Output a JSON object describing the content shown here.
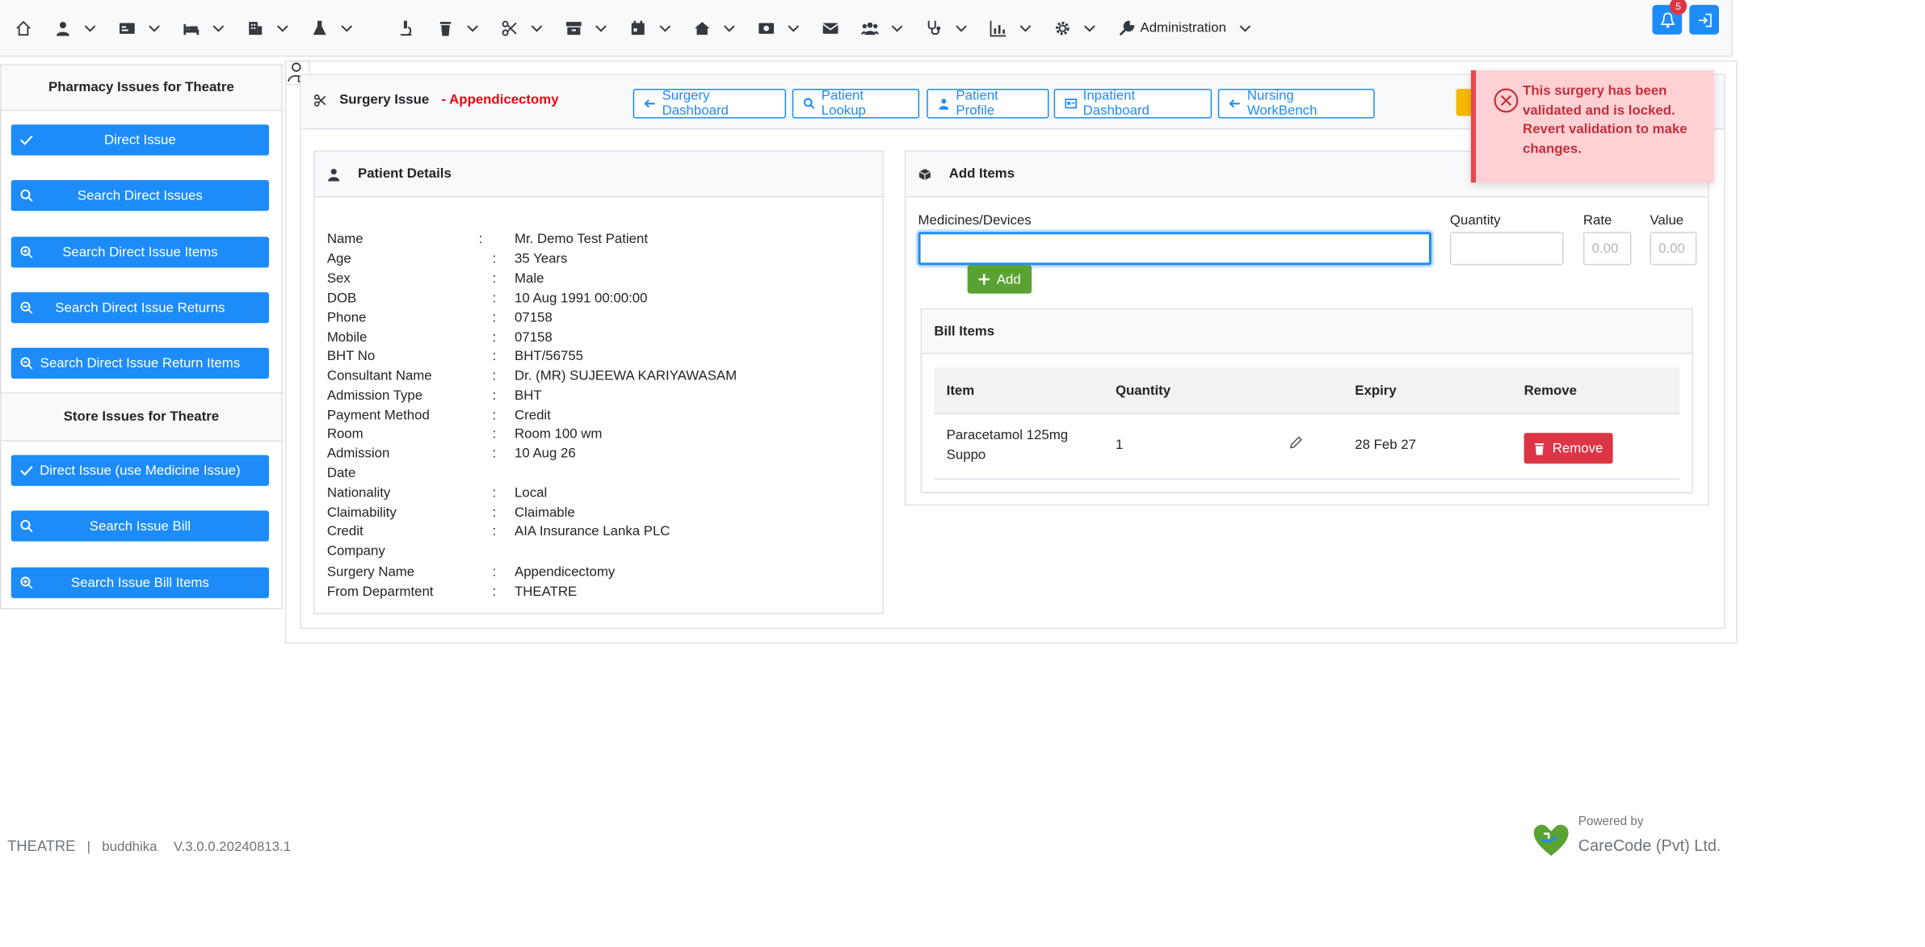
{
  "colors": {
    "primary": "#1d8cf8",
    "danger": "#dc3545",
    "success": "#5aa232",
    "title_accent": "#e50914",
    "toast_bg": "#ffd1d5"
  },
  "navbar": {
    "icons": [
      "home-icon",
      "user-icon",
      "card-icon",
      "bed-icon",
      "building-icon",
      "flask-icon",
      "doctor-icon",
      "microscope-icon",
      "trash-icon",
      "scissors-icon",
      "store-icon",
      "calendar-icon",
      "house-icon",
      "money-icon",
      "mail-icon",
      "users-icon",
      "stethoscope-icon",
      "chart-icon",
      "gear-icon",
      "wrench-icon"
    ],
    "administration_label": "Administration",
    "notification_count": "5"
  },
  "sidebar": {
    "pharmacy_title": "Pharmacy Issues for Theatre",
    "pharmacy_items": [
      {
        "label": "Direct Issue",
        "icon": "check-icon"
      },
      {
        "label": "Search Direct Issues",
        "icon": "search-icon"
      },
      {
        "label": "Search Direct Issue Items",
        "icon": "search-plus-icon"
      },
      {
        "label": "Search Direct Issue Returns",
        "icon": "search-minus-icon"
      },
      {
        "label": "Search Direct Issue Return Items",
        "icon": "search-minus-icon"
      }
    ],
    "store_title": "Store Issues for Theatre",
    "store_items": [
      {
        "label": "Direct Issue (use Medicine Issue)",
        "icon": "check-icon"
      },
      {
        "label": "Search Issue Bill",
        "icon": "search-icon"
      },
      {
        "label": "Search Issue Bill Items",
        "icon": "search-plus-icon"
      }
    ]
  },
  "header": {
    "title": "Surgery Issue",
    "subtitle": "- Appendicectomy",
    "buttons": {
      "surgery_dashboard": "Surgery Dashboard",
      "patient_lookup": "Patient Lookup",
      "patient_profile": "Patient Profile",
      "inpatient_dashboard": "Inpatient Dashboard",
      "nursing_workbench": "Nursing WorkBench"
    }
  },
  "patient_details": {
    "title": "Patient Details",
    "fields": [
      {
        "label": "Name",
        "value": "Mr. Demo Test Patient"
      },
      {
        "label": "Age",
        "value": "35 Years"
      },
      {
        "label": "Sex",
        "value": "Male"
      },
      {
        "label": "DOB",
        "value": "10 Aug 1991 00:00:00"
      },
      {
        "label": "Phone",
        "value": "07158"
      },
      {
        "label": "Mobile",
        "value": "07158"
      },
      {
        "label": "BHT No",
        "value": "BHT/56755"
      },
      {
        "label": "Consultant Name",
        "value": "Dr. (MR) SUJEEWA KARIYAWASAM"
      },
      {
        "label": "Admission Type",
        "value": "BHT"
      },
      {
        "label": "Payment Method",
        "value": "Credit"
      },
      {
        "label": "Room",
        "value": "Room 100 wm"
      },
      {
        "label": "Admission",
        "label2": "Date",
        "value": "10 Aug 26"
      },
      {
        "label": "Nationality",
        "value": "Local"
      },
      {
        "label": "Claimability",
        "value": "Claimable"
      },
      {
        "label": "Credit",
        "label2": "Company",
        "value": "AIA Insurance Lanka PLC"
      },
      {
        "label": "Surgery Name",
        "value": "Appendicectomy"
      },
      {
        "label": "From Deparmtent",
        "value": "THEATRE"
      }
    ]
  },
  "add_items": {
    "title": "Add Items",
    "medicines_label": "Medicines/Devices",
    "medicines_value": "",
    "quantity_label": "Quantity",
    "quantity_value": "",
    "rate_label": "Rate",
    "rate_placeholder": "0.00",
    "value_label": "Value",
    "value_placeholder": "0.00",
    "add_button": "Add"
  },
  "bill_items": {
    "title": "Bill Items",
    "columns": {
      "item": "Item",
      "quantity": "Quantity",
      "expiry": "Expiry",
      "remove": "Remove"
    },
    "rows": [
      {
        "item_line1": "Paracetamol 125mg",
        "item_line2": "Suppo",
        "quantity": "1",
        "expiry": "28 Feb 27",
        "remove_label": "Remove"
      }
    ]
  },
  "toast": {
    "message": "This surgery has been validated and is locked. Revert validation to make changes."
  },
  "footer": {
    "department": "THEATRE",
    "separator": "|",
    "user": "buddhika",
    "version": "V.3.0.0.20240813.1",
    "powered_by": "Powered by",
    "company": "CareCode (Pvt) Ltd."
  }
}
